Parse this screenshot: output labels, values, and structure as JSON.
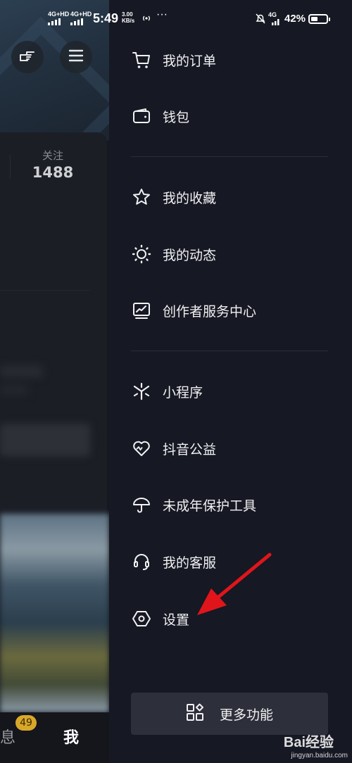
{
  "status_bar": {
    "signal1": "4G+HD",
    "signal2": "4G+HD",
    "time": "5:49",
    "speed_value": "3.00",
    "speed_unit": "KB/s",
    "more": "···",
    "network": "4G",
    "battery": "42%"
  },
  "background": {
    "stat_label": "关注",
    "stat_value": "1488",
    "tab_message": "息",
    "message_badge": "49",
    "tab_me": "我"
  },
  "drawer": {
    "items": [
      {
        "label": "我的订单",
        "icon": "cart-icon"
      },
      {
        "label": "钱包",
        "icon": "wallet-icon"
      },
      {
        "label": "我的收藏",
        "icon": "star-icon"
      },
      {
        "label": "我的动态",
        "icon": "sun-icon"
      },
      {
        "label": "创作者服务中心",
        "icon": "chart-monitor-icon"
      },
      {
        "label": "小程序",
        "icon": "asterisk-icon"
      },
      {
        "label": "抖音公益",
        "icon": "heart-icon"
      },
      {
        "label": "未成年保护工具",
        "icon": "umbrella-icon"
      },
      {
        "label": "我的客服",
        "icon": "headset-icon"
      },
      {
        "label": "设置",
        "icon": "hexagon-settings-icon"
      }
    ],
    "more_button": "更多功能"
  },
  "watermark": {
    "brand": "Bai经验",
    "url": "jingyan.baidu.com"
  },
  "colors": {
    "drawer_bg": "#161823",
    "annotation_arrow": "#e0151b",
    "badge": "#d9a82a"
  }
}
